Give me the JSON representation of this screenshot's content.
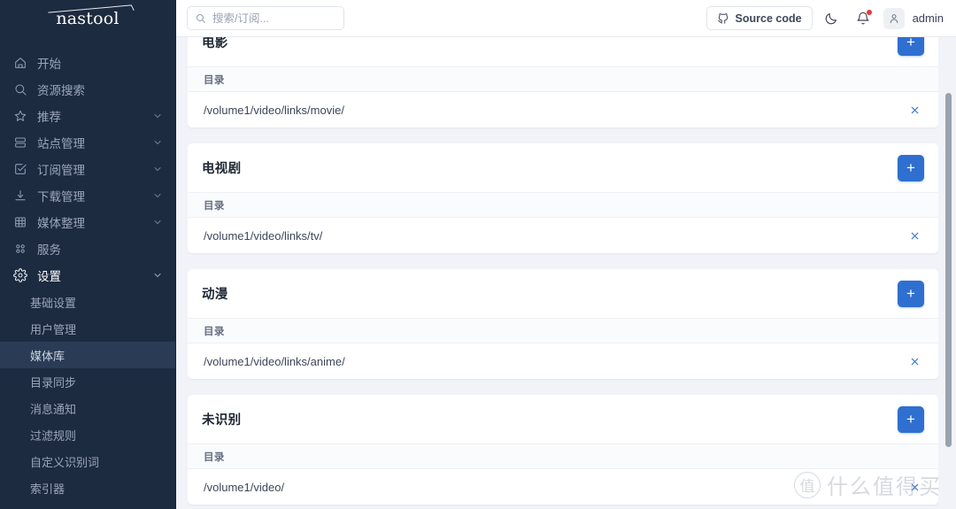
{
  "brand": {
    "name": "nastool"
  },
  "sidebar": {
    "items": [
      {
        "label": "开始",
        "icon": "home-icon",
        "expandable": false,
        "active": false
      },
      {
        "label": "资源搜索",
        "icon": "search-icon",
        "expandable": false,
        "active": false
      },
      {
        "label": "推荐",
        "icon": "star-icon",
        "expandable": true,
        "active": false
      },
      {
        "label": "站点管理",
        "icon": "server-icon",
        "expandable": true,
        "active": false
      },
      {
        "label": "订阅管理",
        "icon": "checkbox-icon",
        "expandable": true,
        "active": false
      },
      {
        "label": "下载管理",
        "icon": "download-icon",
        "expandable": true,
        "active": false
      },
      {
        "label": "媒体整理",
        "icon": "table-icon",
        "expandable": true,
        "active": false
      },
      {
        "label": "服务",
        "icon": "apps-icon",
        "expandable": false,
        "active": false
      },
      {
        "label": "设置",
        "icon": "gear-icon",
        "expandable": true,
        "active": true
      }
    ],
    "subitems": [
      {
        "label": "基础设置",
        "current": false
      },
      {
        "label": "用户管理",
        "current": false
      },
      {
        "label": "媒体库",
        "current": true
      },
      {
        "label": "目录同步",
        "current": false
      },
      {
        "label": "消息通知",
        "current": false
      },
      {
        "label": "过滤规则",
        "current": false
      },
      {
        "label": "自定义识别词",
        "current": false
      },
      {
        "label": "索引器",
        "current": false
      }
    ]
  },
  "topbar": {
    "search_placeholder": "搜索/订阅...",
    "search_value": "",
    "search_icon": "search-icon",
    "source_code_label": "Source code",
    "source_code_icon": "github-icon",
    "theme_icon": "moon-icon",
    "notification_icon": "bell-icon",
    "notification_has_badge": true,
    "avatar_icon": "user-icon",
    "user_name": "admin"
  },
  "content": {
    "column_header": "目录",
    "add_label": "+",
    "delete_icon": "close-icon",
    "cards": [
      {
        "title": "电影",
        "paths": [
          "/volume1/video/links/movie/"
        ]
      },
      {
        "title": "电视剧",
        "paths": [
          "/volume1/video/links/tv/"
        ]
      },
      {
        "title": "动漫",
        "paths": [
          "/volume1/video/links/anime/"
        ]
      },
      {
        "title": "未识别",
        "paths": [
          "/volume1/video/"
        ]
      }
    ]
  },
  "watermark": {
    "mark": "值",
    "text": "什么值得买"
  },
  "colors": {
    "sidebar_bg": "#1d2b41",
    "sidebar_active_bg": "#2a3b55",
    "accent": "#2f6fd0",
    "page_bg": "#f1f3f8",
    "card_bg": "#ffffff",
    "badge": "#e53935"
  }
}
